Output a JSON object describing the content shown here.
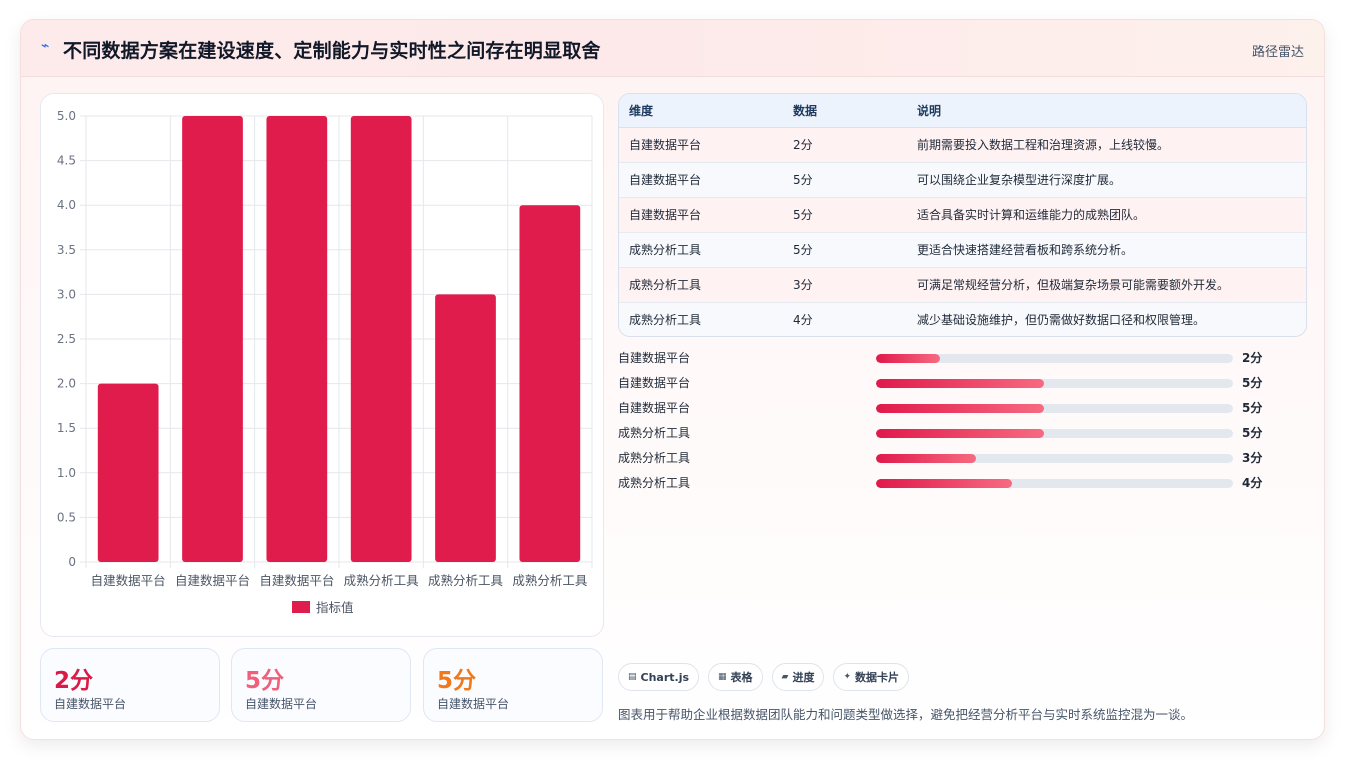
{
  "header": {
    "icon": "line-chart-icon",
    "title": "不同数据方案在建设速度、定制能力与实时性之间存在明显取舍",
    "tag": "路径雷达"
  },
  "chart_data": {
    "type": "bar",
    "categories": [
      "自建数据平台",
      "自建数据平台",
      "自建数据平台",
      "成熟分析工具",
      "成熟分析工具",
      "成熟分析工具"
    ],
    "series": [
      {
        "name": "指标值",
        "values": [
          2,
          5,
          5,
          5,
          3,
          4
        ]
      }
    ],
    "ylim": [
      0,
      5
    ],
    "yticks": [
      "0",
      "0.5",
      "1.0",
      "1.5",
      "2.0",
      "2.5",
      "3.0",
      "3.5",
      "4.0",
      "4.5",
      "5.0"
    ],
    "grid": true,
    "legend_position": "bottom",
    "bar_color": "#df1c4b"
  },
  "stats": [
    {
      "value": "2分",
      "label": "自建数据平台",
      "color": "#d91b46"
    },
    {
      "value": "5分",
      "label": "自建数据平台",
      "color": "#f0607a"
    },
    {
      "value": "5分",
      "label": "自建数据平台",
      "color": "#f07a1a"
    }
  ],
  "table": {
    "headers": [
      "维度",
      "数据",
      "说明"
    ],
    "rows": [
      [
        "自建数据平台",
        "2分",
        "前期需要投入数据工程和治理资源，上线较慢。"
      ],
      [
        "自建数据平台",
        "5分",
        "可以围绕企业复杂模型进行深度扩展。"
      ],
      [
        "自建数据平台",
        "5分",
        "适合具备实时计算和运维能力的成熟团队。"
      ],
      [
        "成熟分析工具",
        "5分",
        "更适合快速搭建经营看板和跨系统分析。"
      ],
      [
        "成熟分析工具",
        "3分",
        "可满足常规经营分析，但极端复杂场景可能需要额外开发。"
      ],
      [
        "成熟分析工具",
        "4分",
        "减少基础设施维护，但仍需做好数据口径和权限管理。"
      ]
    ]
  },
  "progress": [
    {
      "label": "自建数据平台",
      "value": "2分",
      "fraction": 0.18
    },
    {
      "label": "自建数据平台",
      "value": "5分",
      "fraction": 0.47
    },
    {
      "label": "自建数据平台",
      "value": "5分",
      "fraction": 0.47
    },
    {
      "label": "成熟分析工具",
      "value": "5分",
      "fraction": 0.47
    },
    {
      "label": "成熟分析工具",
      "value": "3分",
      "fraction": 0.28
    },
    {
      "label": "成熟分析工具",
      "value": "4分",
      "fraction": 0.38
    }
  ],
  "chips": [
    {
      "icon": "chart-icon",
      "glyph": "▤",
      "label": "Chart.js"
    },
    {
      "icon": "table-icon",
      "glyph": "▦",
      "label": "表格"
    },
    {
      "icon": "progress-icon",
      "glyph": "▰",
      "label": "进度"
    },
    {
      "icon": "card-icon",
      "glyph": "✦",
      "label": "数据卡片"
    }
  ],
  "footnote": "图表用于帮助企业根据数据团队能力和问题类型做选择，避免把经营分析平台与实时系统监控混为一谈。"
}
